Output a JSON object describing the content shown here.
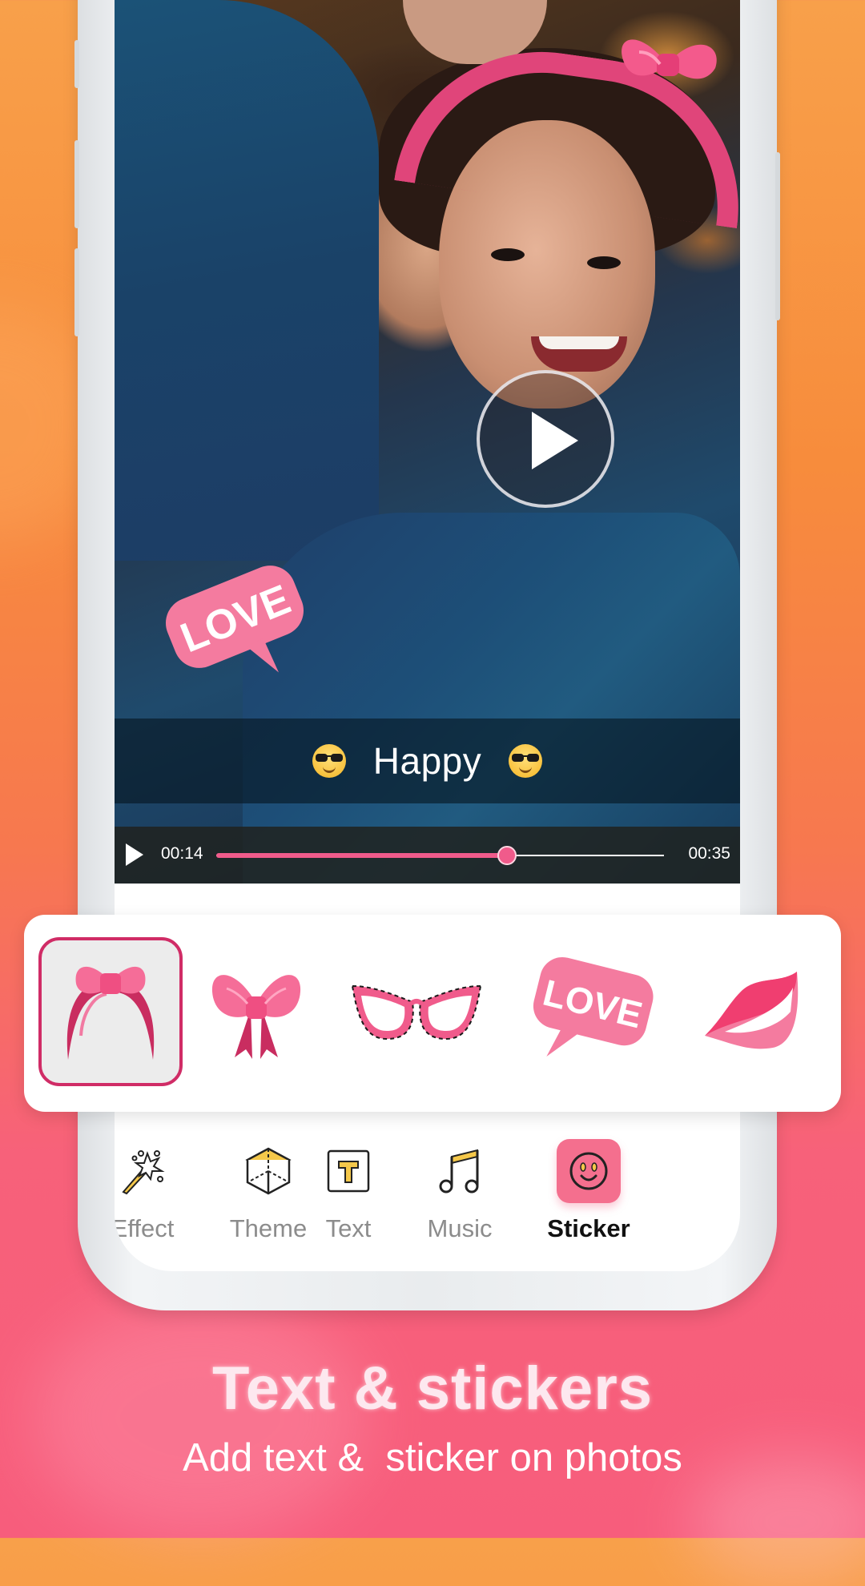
{
  "app": {
    "screen": "video-editor-sticker"
  },
  "colors": {
    "accent": "#f05b8b",
    "selected_border": "#d02c66",
    "active_nav_bg": "#f46f8e",
    "nav_label_inactive": "#8c8c8c",
    "nav_label_active": "#111111"
  },
  "preview": {
    "caption": {
      "text": "Happy",
      "left_emoji": "smiling-face-with-sunglasses",
      "right_emoji": "smiling-face-with-sunglasses"
    },
    "overlay_sticker": "LOVE",
    "play_button_icon": "play-icon"
  },
  "player": {
    "current_time": "00:14",
    "duration": "00:35",
    "progress": 0.65,
    "play_icon": "play-icon"
  },
  "sticker_tray": {
    "items": [
      {
        "name": "headband",
        "selected": true
      },
      {
        "name": "bow",
        "selected": false
      },
      {
        "name": "cat-eye-glasses",
        "selected": false
      },
      {
        "name": "love-speech-bubble",
        "label": "LOVE",
        "selected": false
      },
      {
        "name": "lips",
        "selected": false
      }
    ]
  },
  "bottom_nav": {
    "items": [
      {
        "label": "Effect",
        "icon": "magic-wand-icon",
        "active": false
      },
      {
        "label": "Theme",
        "icon": "cube-icon",
        "active": false
      },
      {
        "label": "Text",
        "icon": "text-box-icon",
        "active": false
      },
      {
        "label": "Music",
        "icon": "music-note-icon",
        "active": false
      },
      {
        "label": "Sticker",
        "icon": "smiley-icon",
        "active": true
      }
    ]
  },
  "promo": {
    "title": "Text & stickers",
    "subtitle": "Add text &  sticker on photos"
  }
}
